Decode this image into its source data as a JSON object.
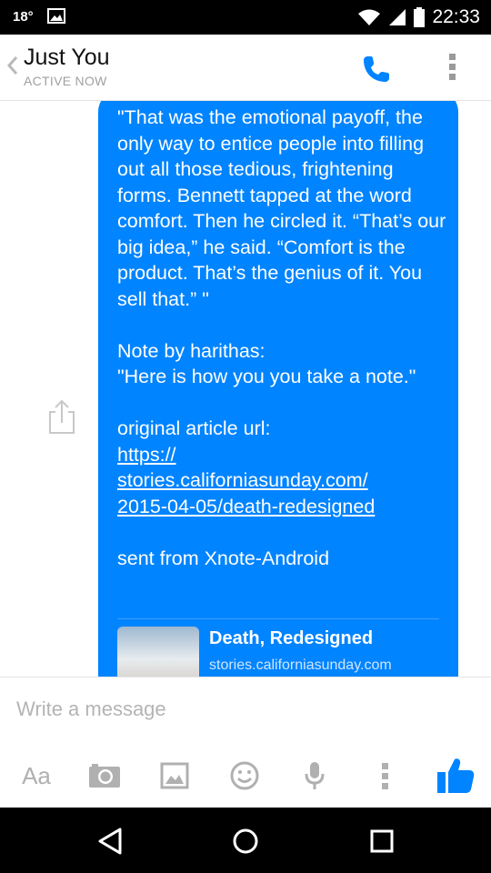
{
  "status_bar": {
    "temperature": "18°",
    "time": "22:33"
  },
  "header": {
    "title": "Just You",
    "subtitle": "ACTIVE NOW"
  },
  "message": {
    "quote": "\"That was the emotional payoff, the only way to entice people into filling out all those tedious, frightening forms. Bennett tapped at the word comfort. Then he circled it. “That’s our big idea,” he said. “Comfort is the product. That’s the genius of it. You sell that.” \"",
    "note_label": "Note by harithas:",
    "note": "\"Here is how you you take a note.\"",
    "url_label": "original article url:",
    "url_part1": "https://",
    "url_part2": "stories.californiasunday.com/",
    "url_part3": "2015-04-05/death-redesigned",
    "signature": "sent from Xnote-Android",
    "preview_title": "Death, Redesigned",
    "preview_url": "stories.californiasunday.com"
  },
  "composer": {
    "placeholder": "Write a message",
    "aa_label": "Aa"
  },
  "colors": {
    "accent": "#0084ff",
    "icon_gray": "#b0b0b0"
  }
}
